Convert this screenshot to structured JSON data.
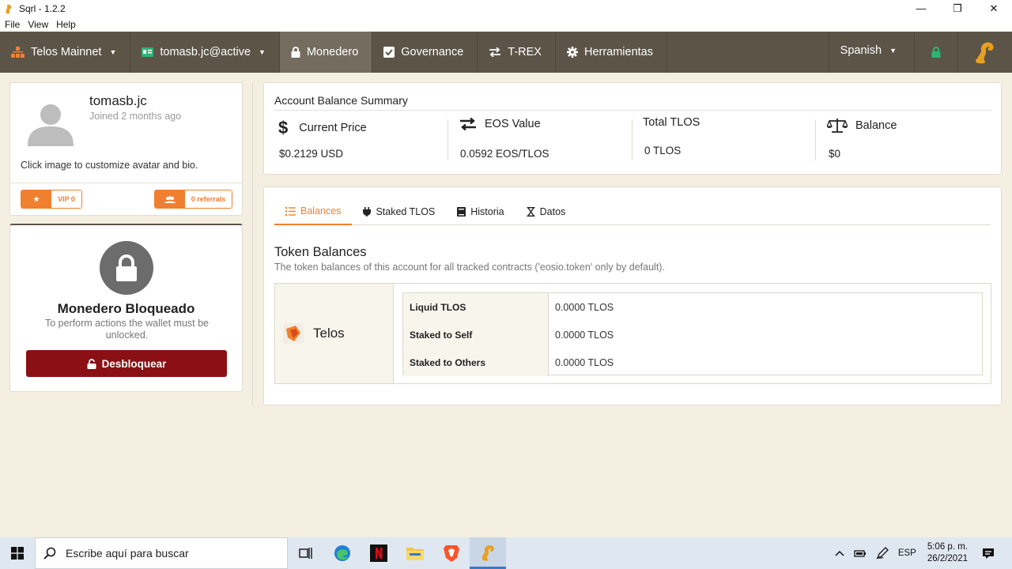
{
  "window": {
    "title": "Sqrl - 1.2.2",
    "controls": {
      "minimize": "—",
      "restore": "❐",
      "close": "✕"
    }
  },
  "menu": [
    "File",
    "View",
    "Help"
  ],
  "nav": {
    "network": "Telos Mainnet",
    "account": "tomasb.jc@active",
    "wallet": "Monedero",
    "governance": "Governance",
    "trex": "T-REX",
    "tools": "Herramientas",
    "language": "Spanish"
  },
  "profile": {
    "name": "tomasb.jc",
    "joined": "Joined 2 months ago",
    "hint": "Click image to customize avatar and bio.",
    "vip": "VIP 0",
    "referrals": "0 referrals"
  },
  "lock": {
    "title": "Monedero Bloqueado",
    "message": "To perform actions the wallet must be unlocked.",
    "button": "Desbloquear"
  },
  "summary": {
    "title": "Account Balance Summary",
    "current_price_label": "Current Price",
    "current_price": "$0.2129 USD",
    "eos_value_label": "EOS Value",
    "eos_value": "0.0592 EOS/TLOS",
    "total_label": "Total TLOS",
    "total": "0 TLOS",
    "balance_label": "Balance",
    "balance": "$0"
  },
  "tabs": [
    "Balances",
    "Staked TLOS",
    "Historia",
    "Datos"
  ],
  "token_balances": {
    "title": "Token Balances",
    "description": "The token balances of this account for all tracked contracts ('eosio.token' only by default).",
    "token": "Telos",
    "rows": [
      {
        "label": "Liquid TLOS",
        "value": "0.0000 TLOS"
      },
      {
        "label": "Staked to Self",
        "value": "0.0000 TLOS"
      },
      {
        "label": "Staked to Others",
        "value": "0.0000 TLOS"
      }
    ]
  },
  "taskbar": {
    "search_placeholder": "Escribe aquí para buscar",
    "language": "ESP",
    "time": "5:06 p. m.",
    "date": "26/2/2021"
  },
  "colors": {
    "nav_bg": "#5d5448",
    "accent": "#f08030",
    "unlock_button": "#8b1015",
    "page_bg": "#f4efe0"
  }
}
